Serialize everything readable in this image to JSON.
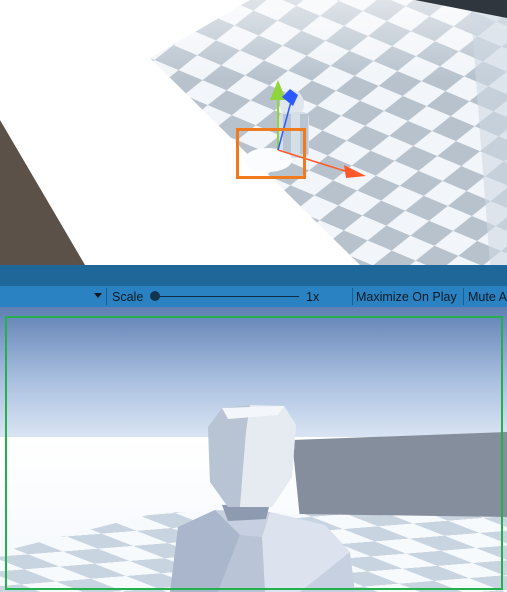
{
  "toolbar": {
    "display_dropdown": "",
    "scale_label": "Scale",
    "scale_value": "1x",
    "scale_slider_fraction": 0,
    "maximize_on_play": "Maximize On Play",
    "mute_audio": "Mute A"
  },
  "colors": {
    "selection_outline": "#f07a1e",
    "game_frame_outline": "#22b14c",
    "toolbar_background": "#2b82c2",
    "y_axis_gizmo": "#8fd53b",
    "x_axis_gizmo": "#ff5a2c",
    "z_axis_gizmo": "#2c5aff"
  }
}
